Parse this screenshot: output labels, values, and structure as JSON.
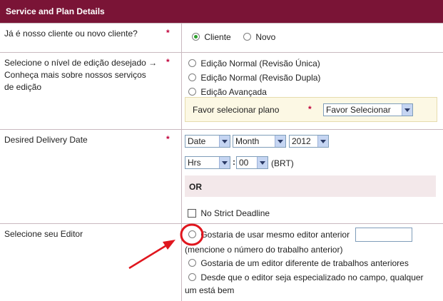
{
  "header": {
    "title": "Service and Plan Details"
  },
  "required_mark": "*",
  "client": {
    "label": "Já é nosso cliente ou novo cliente?",
    "options": [
      {
        "label": "Cliente",
        "checked": true
      },
      {
        "label": "Novo",
        "checked": false
      }
    ]
  },
  "edit_level": {
    "label": "Selecione o nível de edição desejado → Conheça mais sobre nossos serviços de edição",
    "options": [
      {
        "label": "Edição Normal (Revisão Única)"
      },
      {
        "label": "Edição Normal (Revisão Dupla)"
      },
      {
        "label": "Edição Avançada"
      }
    ],
    "plan_label": "Favor selecionar plano",
    "plan_select": "Favor Selecionar"
  },
  "delivery": {
    "label": "Desired Delivery Date",
    "date": "Date",
    "month": "Month",
    "year": "2012",
    "hrs": "Hrs",
    "time_separator": ":",
    "minutes": "00",
    "timezone": "(BRT)",
    "or": "OR",
    "no_deadline": "No Strict Deadline"
  },
  "editor": {
    "label": "Selecione seu Editor",
    "option1": "Gostaria de usar mesmo editor anterior",
    "option1_note": "(mencione o número do trabalho anterior)",
    "option2": "Gostaria de um editor diferente de trabalhos anteriores",
    "option3_line1": "Desde que o editor seja especializado no campo, qualquer",
    "option3_line2": "um está bem"
  },
  "colors": {
    "header": "#7a1436",
    "annotation": "#e0161e",
    "required": "#c0003a"
  }
}
